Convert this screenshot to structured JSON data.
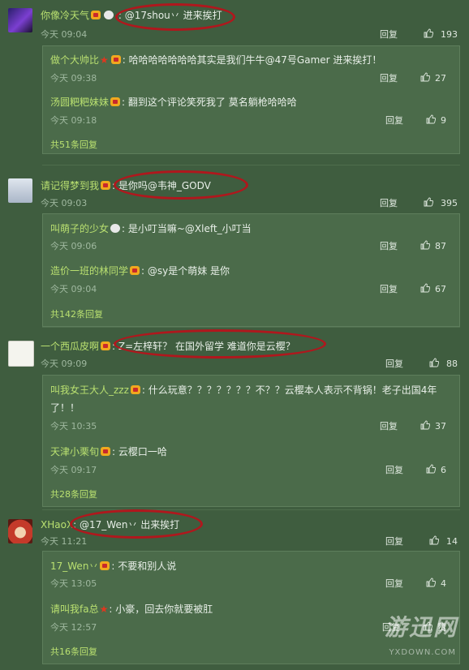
{
  "ui": {
    "reply_label": "回复"
  },
  "threads": [
    {
      "user": "你像冷天气",
      "text": "@17shou丷 进来挨打",
      "time": "今天 09:04",
      "likes": "193",
      "replies": [
        {
          "user": "做个大帅比",
          "text": "哈哈哈哈哈哈哈其实是我们牛牛@47号Gamer 进来挨打！",
          "time": "今天 09:38",
          "likes": "27"
        },
        {
          "user": "汤圆粑粑妹妹",
          "text": "翻到这个评论笑死我了 莫名躺枪哈哈哈",
          "time": "今天 09:18",
          "likes": "9"
        }
      ],
      "more": "共51条回复"
    },
    {
      "user": "请记得梦到我",
      "text": "是你吗@韦神_GODV",
      "time": "今天 09:03",
      "likes": "395",
      "replies": [
        {
          "user": "叫萌子的少女",
          "text": "是小叮当嘛~@Xleft_小叮当",
          "time": "今天 09:06",
          "likes": "87"
        },
        {
          "user": "造价一班的林同学",
          "text": "@sy是个萌妹 是你",
          "time": "今天 09:04",
          "likes": "67"
        }
      ],
      "more": "共142条回复"
    },
    {
      "user": "一个西瓜皮啊",
      "text": "Z=左梓轩？ 在国外留学 难道你是云樱？",
      "time": "今天 09:09",
      "likes": "88",
      "replies": [
        {
          "user": "叫我女王大人_zzz",
          "text": "什么玩意？？？？？？？不？？云樱本人表示不背锅！老子出国4年",
          "text2": "了！！",
          "time": "今天 10:35",
          "likes": "37"
        },
        {
          "user": "天津小栗旬",
          "text": "云樱口一哈",
          "time": "今天 09:17",
          "likes": "6"
        }
      ],
      "more": "共28条回复"
    },
    {
      "user": "XHaoX",
      "text": "@17_Wen丷 出来挨打",
      "time": "今天 11:21",
      "likes": "14",
      "replies": [
        {
          "user": "17_Wen丷",
          "text": "不要和别人说",
          "time": "今天 13:05",
          "likes": "4"
        },
        {
          "user": "请叫我fa总",
          "text": "小豪，回去你就要被肛",
          "time": "今天 12:57",
          "likes": "赞"
        }
      ],
      "more": "共16条回复"
    }
  ],
  "watermark": {
    "logo": "游迅网",
    "url": "YXDOWN.COM"
  },
  "colors": {
    "background": "#3f5d3f",
    "username": "#b9e070",
    "highlight_ring": "#b0171d"
  }
}
